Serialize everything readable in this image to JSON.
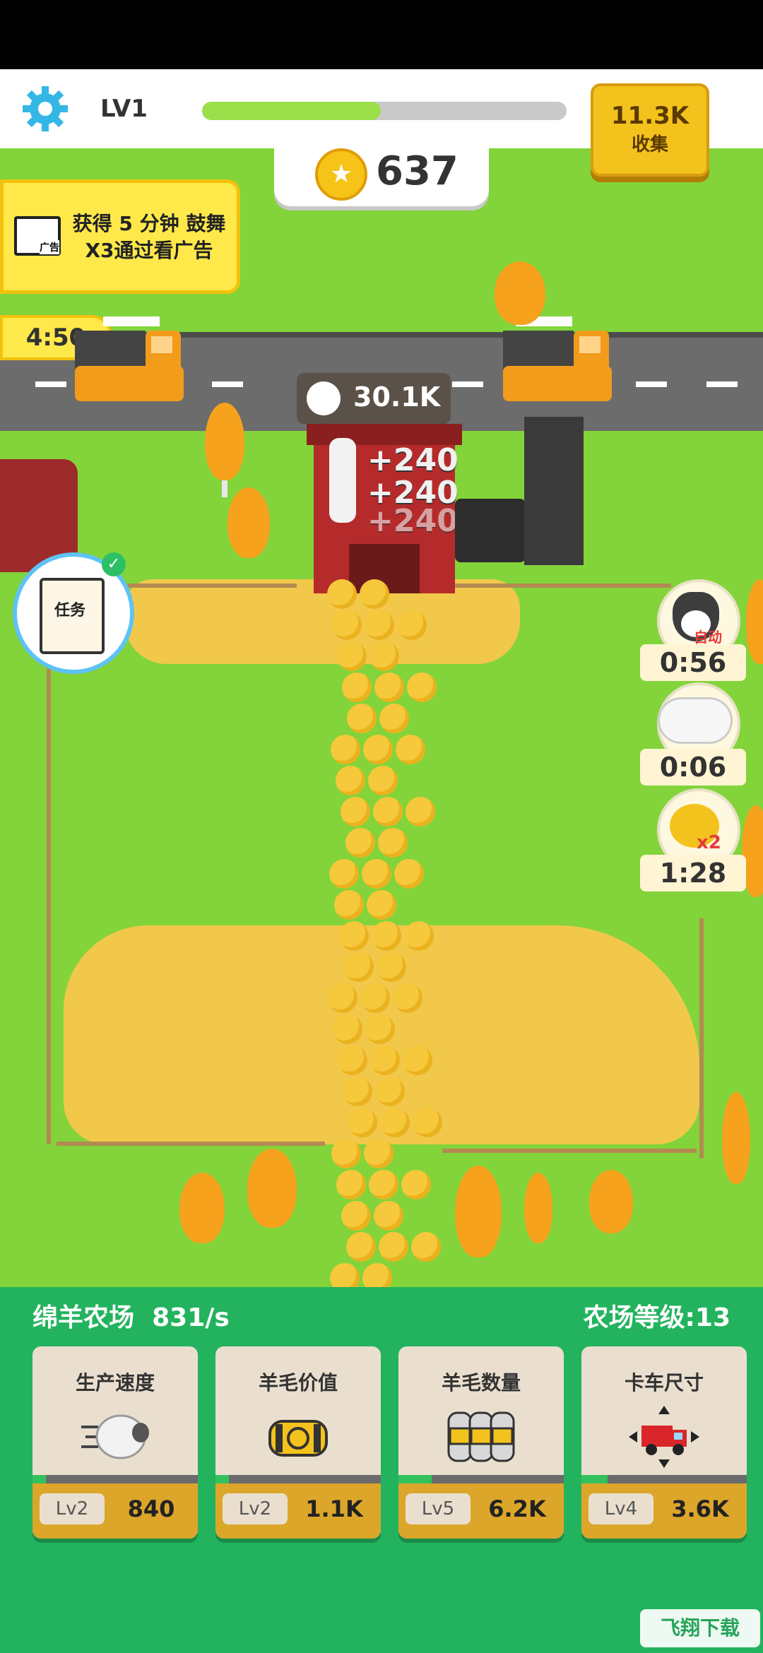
{
  "header": {
    "level": "LV1",
    "progress": 0.49,
    "collect_value": "11.3K",
    "collect_label": "收集",
    "coins": "637"
  },
  "ad": {
    "line1": "获得 5 分钟 鼓舞",
    "line2": "X3通过看广告",
    "icon_text": "广告",
    "timer": "4:50"
  },
  "wool_counter": "30.1K",
  "barn_labels": [
    "+240",
    "+240",
    "+240"
  ],
  "task": {
    "label": "任务"
  },
  "boosters": [
    {
      "name": "dog",
      "tag": "自动",
      "time": "0:56"
    },
    {
      "name": "sheep-flock",
      "tag": "",
      "time": "0:06"
    },
    {
      "name": "golden-sheep",
      "tag": "x2",
      "time": "1:28"
    }
  ],
  "farm": {
    "name": "绵羊农场",
    "rate": "831/s",
    "level_label": "农场等级:13"
  },
  "upgrades": [
    {
      "title": "生产速度",
      "level": "Lv2",
      "cost": "840",
      "progress": 0.08
    },
    {
      "title": "羊毛价值",
      "level": "Lv2",
      "cost": "1.1K",
      "progress": 0.08
    },
    {
      "title": "羊毛数量",
      "level": "Lv5",
      "cost": "6.2K",
      "progress": 0.2
    },
    {
      "title": "卡车尺寸",
      "level": "Lv4",
      "cost": "3.6K",
      "progress": 0.16
    }
  ],
  "watermark": "飞翔下载",
  "colors": {
    "panel": "#23b35e",
    "grass": "#82d43a",
    "accent": "#f3c21d"
  }
}
